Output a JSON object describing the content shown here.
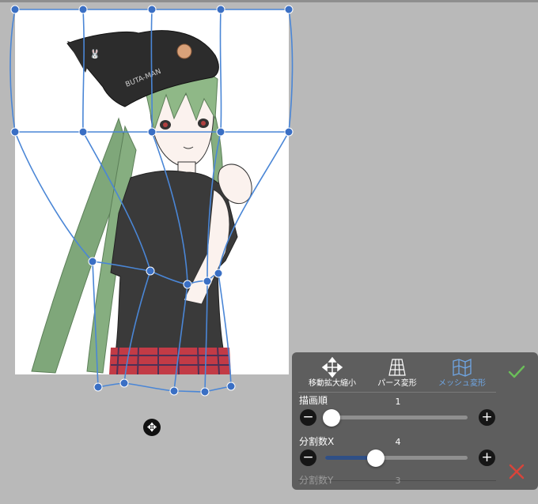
{
  "toolbar": {
    "tools": [
      {
        "label": "移動拡大縮小",
        "icon": "move-icon",
        "active": false
      },
      {
        "label": "パース変形",
        "icon": "perspective-grid-icon",
        "active": false
      },
      {
        "label": "メッシュ変形",
        "icon": "mesh-map-icon",
        "active": true
      }
    ],
    "active_color": "#6fa6e4"
  },
  "settings": {
    "draw_order": {
      "label": "描画順",
      "value": "1",
      "level": 0.0
    },
    "divisions_x": {
      "label": "分割数X",
      "value": "4",
      "level": 0.28
    },
    "divisions_y": {
      "label": "分割数Y",
      "value": "3"
    }
  },
  "actions": {
    "confirm_icon": "check-icon",
    "cancel_icon": "close-icon",
    "confirm_color": "#6bbf59",
    "cancel_color": "#d9443a"
  },
  "canvas": {
    "hat_text": "BUTA-MAN",
    "mesh_color": "#4a86d6",
    "handle_icon": "move-icon"
  }
}
